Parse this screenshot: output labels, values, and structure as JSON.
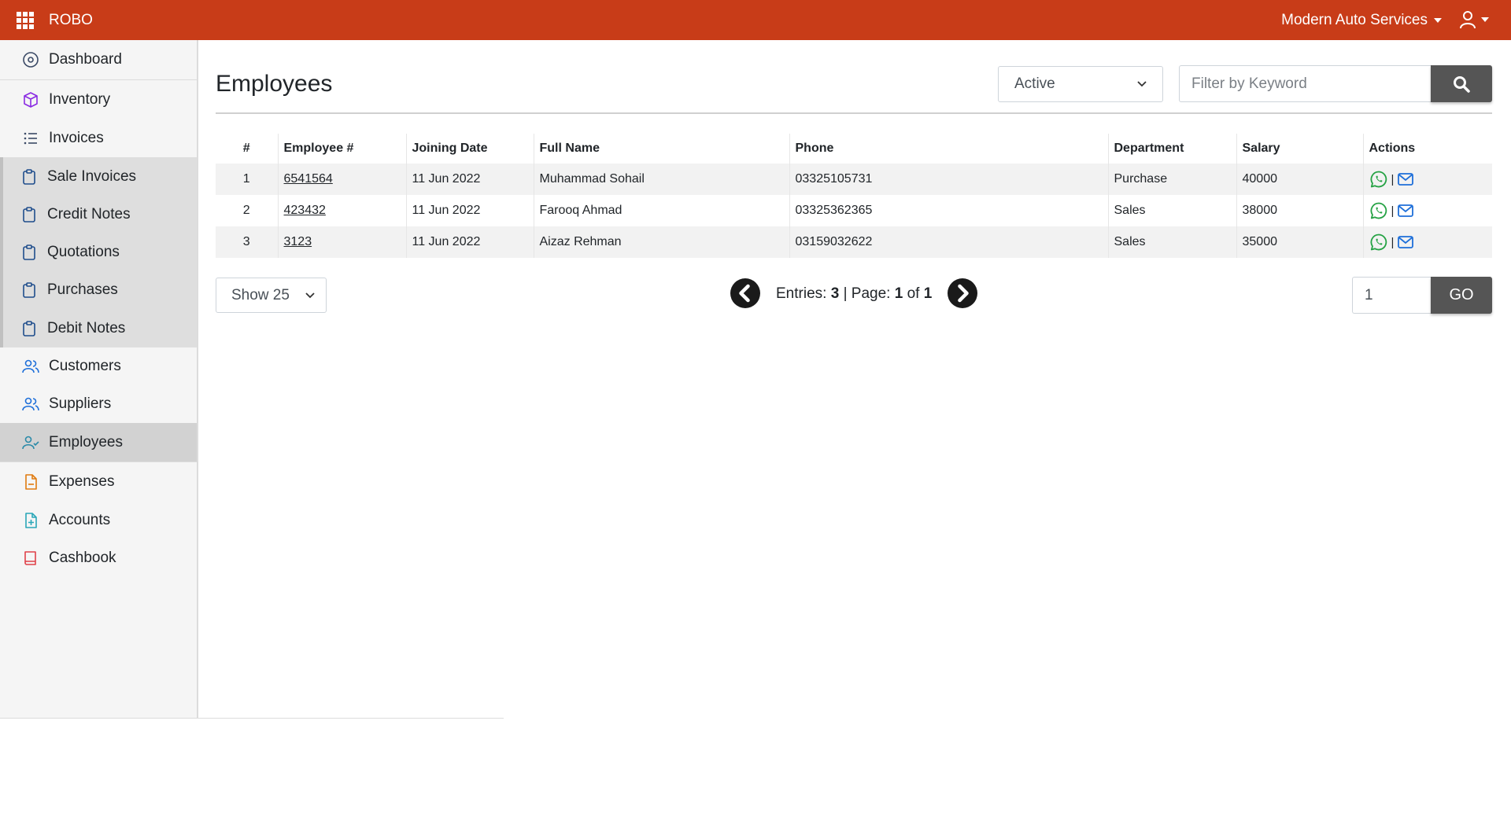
{
  "header": {
    "brand": "ROBO",
    "company": "Modern Auto Services",
    "apps_icon": "grid-icon",
    "user_icon": "user-icon"
  },
  "sidebar": {
    "items": [
      {
        "label": "Dashboard",
        "icon": "dashboard-icon"
      },
      {
        "label": "Inventory",
        "icon": "box-icon"
      },
      {
        "label": "Invoices",
        "icon": "list-icon"
      },
      {
        "label": "Sale Invoices",
        "icon": "clipboard-icon"
      },
      {
        "label": "Credit Notes",
        "icon": "clipboard-icon"
      },
      {
        "label": "Quotations",
        "icon": "clipboard-icon"
      },
      {
        "label": "Purchases",
        "icon": "clipboard-icon"
      },
      {
        "label": "Debit Notes",
        "icon": "clipboard-icon"
      },
      {
        "label": "Customers",
        "icon": "people-icon"
      },
      {
        "label": "Suppliers",
        "icon": "people-icon"
      },
      {
        "label": "Employees",
        "icon": "person-check-icon"
      },
      {
        "label": "Expenses",
        "icon": "document-icon"
      },
      {
        "label": "Accounts",
        "icon": "file-plus-icon"
      },
      {
        "label": "Cashbook",
        "icon": "book-icon"
      }
    ],
    "active": "Employees"
  },
  "main": {
    "title": "Employees",
    "status_filter": "Active",
    "search_placeholder": "Filter by Keyword",
    "table": {
      "headers": [
        "#",
        "Employee #",
        "Joining Date",
        "Full Name",
        "Phone",
        "Department",
        "Salary",
        "Actions"
      ],
      "rows": [
        {
          "n": "1",
          "emp": "6541564",
          "date": "11 Jun 2022",
          "name": "Muhammad Sohail",
          "phone": "03325105731",
          "dept": "Purchase",
          "salary": "40000"
        },
        {
          "n": "2",
          "emp": "423432",
          "date": "11 Jun 2022",
          "name": "Farooq Ahmad",
          "phone": "03325362365",
          "dept": "Sales",
          "salary": "38000"
        },
        {
          "n": "3",
          "emp": "3123",
          "date": "11 Jun 2022",
          "name": "Aizaz Rehman",
          "phone": "03159032622",
          "dept": "Sales",
          "salary": "35000"
        }
      ],
      "action_separator": "|"
    },
    "pagination": {
      "page_size": "Show 25",
      "entries_label": "Entries:",
      "entries_count": "3",
      "page_label": "| Page:",
      "page_current": "1",
      "of_label": "of",
      "page_total": "1",
      "page_input": "1",
      "go_label": "GO"
    }
  },
  "colors": {
    "topbar": "#c83c18",
    "whatsapp": "#25a244",
    "mail": "#1e6fd9",
    "button_dark": "#555555"
  }
}
